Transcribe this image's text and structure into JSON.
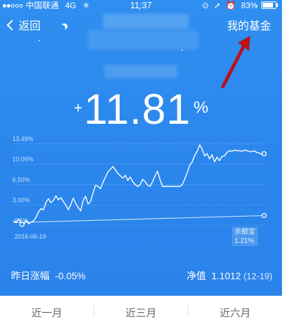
{
  "status_bar": {
    "carrier": "中国联通",
    "network": "4G",
    "time": "11:37",
    "battery": "83%"
  },
  "nav": {
    "back_label": "返回",
    "right_label": "我的基金"
  },
  "headline": {
    "sign": "+",
    "value": "11.81",
    "unit": "%"
  },
  "chart": {
    "y_tick_labels": [
      "13.49%",
      "10.00%",
      "6.50%",
      "3.00%",
      "-0.5%"
    ],
    "start_date": "2016-06-19",
    "benchmark_label": "余额宝",
    "benchmark_value": "1.21%",
    "series_color": "#ffffff",
    "background": "#2b86ec"
  },
  "chart_data": {
    "type": "line",
    "y_ticks": [
      13.49,
      10.0,
      6.5,
      3.0,
      -0.5
    ],
    "x_start_label": "2016-06-19",
    "ylim": [
      -0.5,
      13.49
    ],
    "series": [
      {
        "values": [
          0.2,
          0.1,
          0.6,
          0.0,
          -0.3,
          0.4,
          -0.2,
          0.1,
          0.3,
          0.9,
          1.8,
          2.4,
          2.2,
          3.5,
          4.1,
          3.4,
          3.8,
          4.6,
          3.9,
          4.3,
          3.6,
          3.0,
          2.2,
          3.1,
          4.2,
          3.3,
          2.6,
          2.0,
          3.8,
          4.5,
          3.2,
          3.6,
          5.1,
          6.4,
          6.2,
          5.8,
          6.9,
          7.8,
          8.7,
          9.1,
          9.6,
          9.0,
          8.4,
          8.0,
          7.6,
          8.1,
          7.2,
          7.8,
          7.0,
          6.5,
          6.2,
          6.5,
          7.4,
          7.0,
          6.4,
          6.2,
          7.0,
          8.0,
          8.8,
          7.4,
          6.2,
          6.2,
          6.2,
          6.2,
          6.2,
          6.2,
          6.2,
          6.2,
          6.5,
          7.5,
          8.6,
          9.8,
          10.4,
          11.5,
          12.2,
          13.3,
          12.6,
          11.4,
          11.8,
          10.9,
          11.6,
          10.4,
          11.2,
          10.6,
          11.3,
          11.4,
          12.0,
          12.3,
          12.2,
          12.4,
          12.3,
          12.3,
          12.2,
          12.4,
          12.3,
          12.2,
          12.1,
          12.3,
          12.0,
          11.9,
          11.7,
          11.8
        ]
      },
      {
        "name": "余额宝",
        "values": [
          0.0,
          1.21
        ]
      }
    ]
  },
  "stats": {
    "yesterday_label": "昨日涨幅",
    "yesterday_value": "-0.05%",
    "nav_label": "净值",
    "nav_value": "1.1012",
    "nav_date": "(12-19)"
  },
  "tabs": [
    {
      "label": "近一月"
    },
    {
      "label": "近三月"
    },
    {
      "label": "近六月"
    }
  ],
  "annotation_color": "#b8121c"
}
